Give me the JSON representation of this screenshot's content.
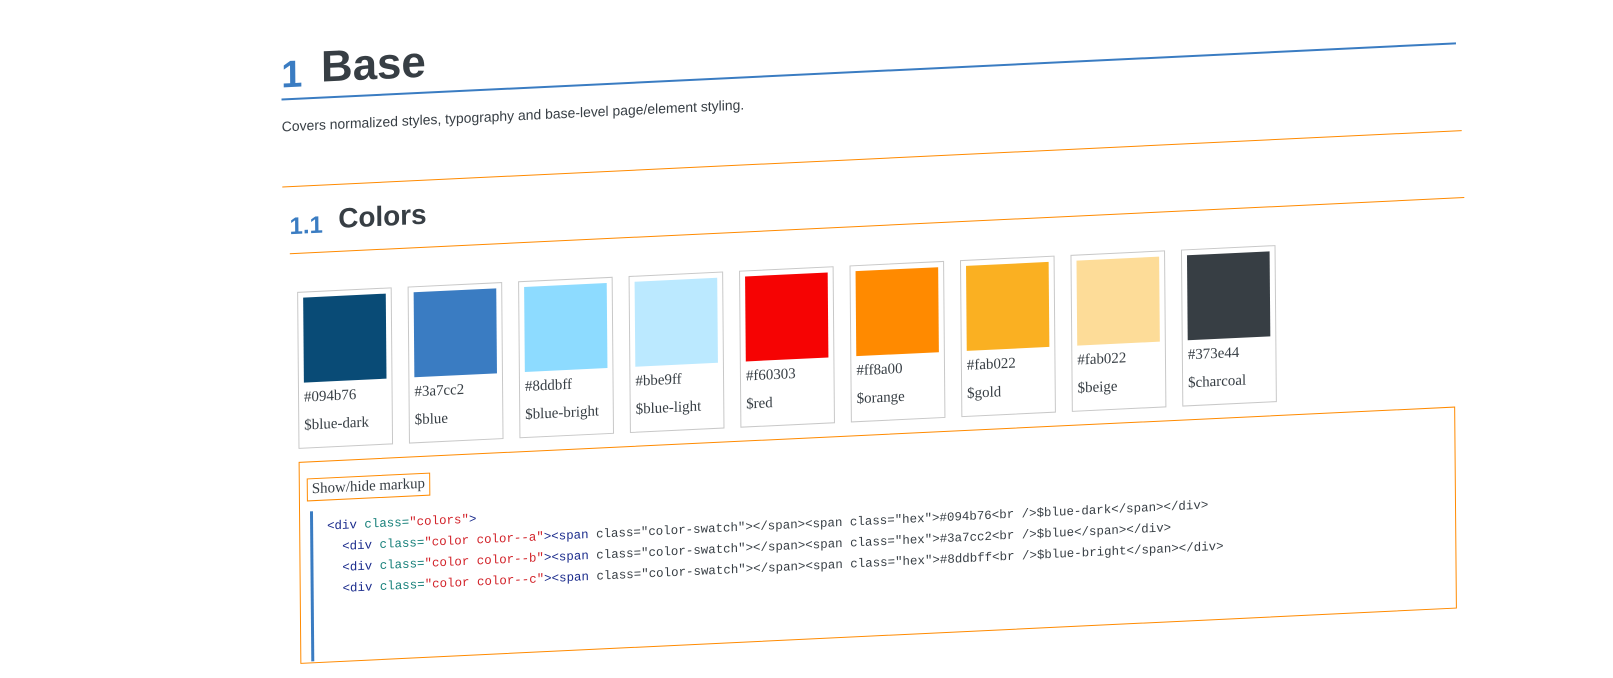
{
  "section": {
    "number": "1",
    "title": "Base",
    "description": "Covers normalized styles, typography and base-level page/element styling."
  },
  "subsection": {
    "number": "1.1",
    "title": "Colors"
  },
  "colors": [
    {
      "hex": "#094b76",
      "name": "$blue-dark",
      "swatch": "#094b76"
    },
    {
      "hex": "#3a7cc2",
      "name": "$blue",
      "swatch": "#3a7cc2"
    },
    {
      "hex": "#8ddbff",
      "name": "$blue-bright",
      "swatch": "#8ddbff"
    },
    {
      "hex": "#bbe9ff",
      "name": "$blue-light",
      "swatch": "#bbe9ff"
    },
    {
      "hex": "#f60303",
      "name": "$red",
      "swatch": "#f60303"
    },
    {
      "hex": "#ff8a00",
      "name": "$orange",
      "swatch": "#ff8a00"
    },
    {
      "hex": "#fab022",
      "name": "$gold",
      "swatch": "#fab022"
    },
    {
      "hex": "#fab022",
      "name": "$beige",
      "swatch": "#fddc98"
    },
    {
      "hex": "#373e44",
      "name": "$charcoal",
      "swatch": "#373e44"
    }
  ],
  "markup": {
    "toggle_label": "Show/hide markup",
    "lines": [
      {
        "indent": "",
        "tag_open": "<div ",
        "attr": "class=",
        "cls": "\"colors\"",
        "tag_close": ">",
        "rest": ""
      },
      {
        "indent": "  ",
        "tag_open": "<div ",
        "attr": "class=",
        "cls": "\"color color--a\"",
        "tag_close": "><span ",
        "rest": "class=\"color-swatch\"></span><span class=\"hex\">#094b76<br />$blue-dark</span></div>"
      },
      {
        "indent": "  ",
        "tag_open": "<div ",
        "attr": "class=",
        "cls": "\"color color--b\"",
        "tag_close": "><span ",
        "rest": "class=\"color-swatch\"></span><span class=\"hex\">#3a7cc2<br />$blue</span></div>"
      },
      {
        "indent": "  ",
        "tag_open": "<div ",
        "attr": "class=",
        "cls": "\"color color--c\"",
        "tag_close": "><span ",
        "rest": "class=\"color-swatch\"></span><span class=\"hex\">#8ddbff<br />$blue-bright</span></div>"
      }
    ]
  },
  "theme": {
    "accent_blue": "#3a7cc2",
    "accent_orange": "#ff8a00",
    "text": "#373e44"
  }
}
